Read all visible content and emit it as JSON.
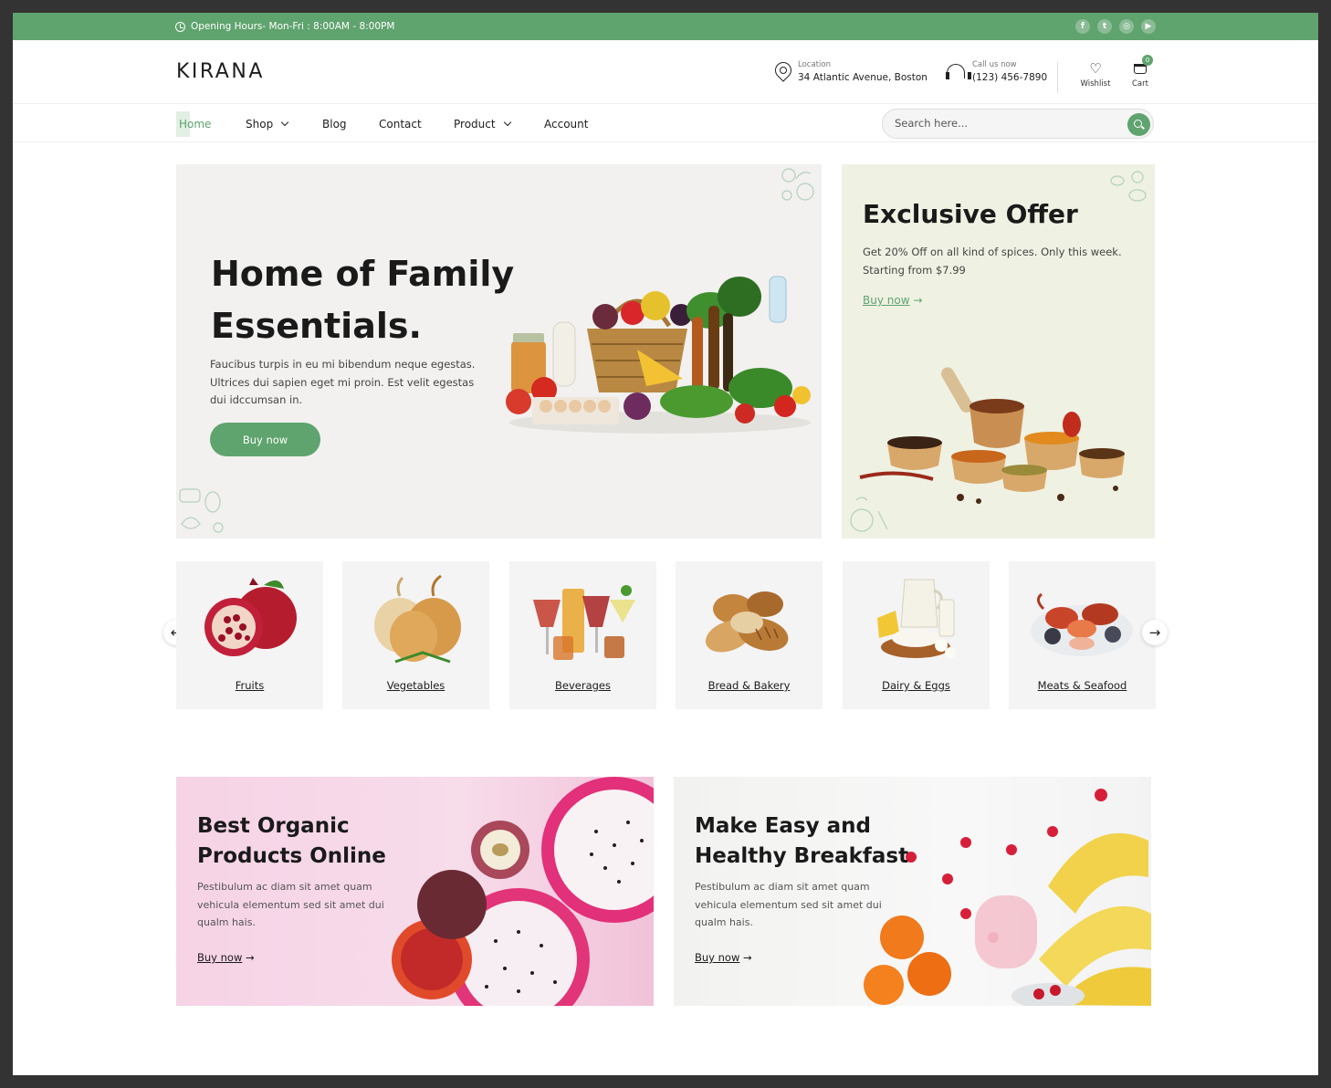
{
  "topbar": {
    "hours": "Opening Hours- Mon-Fri : 8:00AM - 8:00PM",
    "socials": [
      {
        "icon": "facebook-icon",
        "glyph": "f"
      },
      {
        "icon": "twitter-icon",
        "glyph": "t"
      },
      {
        "icon": "instagram-icon",
        "glyph": "◎"
      },
      {
        "icon": "youtube-icon",
        "glyph": "▶"
      }
    ]
  },
  "header": {
    "logo": "KIRANA",
    "location_label": "Location",
    "location_value": "34 Atlantic Avenue, Boston",
    "call_label": "Call us now",
    "call_value": "(123) 456-7890",
    "wishlist_label": "Wishlist",
    "cart_label": "Cart",
    "cart_count": "0"
  },
  "nav": {
    "home": "Home",
    "shop": "Shop",
    "blog": "Blog",
    "contact": "Contact",
    "product": "Product",
    "account": "Account",
    "search_placeholder": "Search here..."
  },
  "hero": {
    "title": "Home of Family Essentials.",
    "body": "Faucibus turpis in eu mi bibendum neque egestas. Ultrices dui sapien eget mi proin. Est velit egestas dui idccumsan in.",
    "button": "Buy now"
  },
  "offer": {
    "title": "Exclusive Offer",
    "body": "Get 20% Off on all kind of spices. Only this week. Starting from $7.99",
    "link": "Buy now",
    "arrow": "→"
  },
  "categories": [
    {
      "label": "Fruits"
    },
    {
      "label": "Vegetables"
    },
    {
      "label": "Beverages"
    },
    {
      "label": "Bread & Bakery"
    },
    {
      "label": "Dairy & Eggs"
    },
    {
      "label": "Meats & Seafood"
    }
  ],
  "carousel": {
    "prev": "←",
    "next": "→"
  },
  "promos": [
    {
      "title": "Best Organic Products Online",
      "body": "Pestibulum ac diam sit amet quam vehicula elementum sed sit amet dui qualm hais.",
      "link": "Buy now",
      "arrow": "→"
    },
    {
      "title": "Make Easy and Healthy Breakfast",
      "body": "Pestibulum ac diam sit amet quam vehicula elementum sed sit amet dui qualm hais.",
      "link": "Buy now",
      "arrow": "→"
    }
  ],
  "colors": {
    "accent": "#5fa36e",
    "hero_bg": "#f2f1ef",
    "offer_bg": "#eff1e3",
    "category_bg": "#f4f4f4"
  }
}
